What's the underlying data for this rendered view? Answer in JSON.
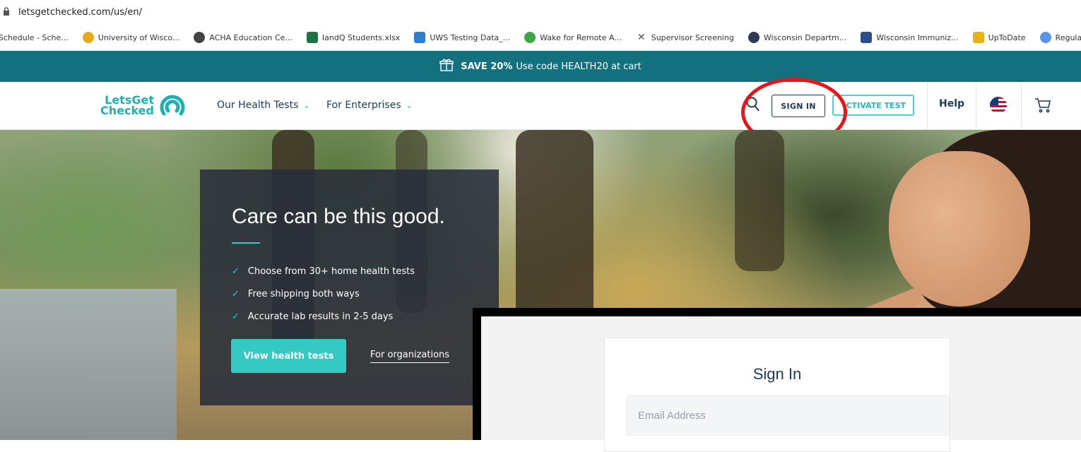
{
  "browser": {
    "url": "letsgetchecked.com/us/en/",
    "bookmarks": [
      {
        "label": "Schedule - Sche...",
        "icon": "calendar-icon",
        "color": "#ffffff"
      },
      {
        "label": "University of Wisco...",
        "icon": "university-icon",
        "color": "#e8a91c"
      },
      {
        "label": "ACHA Education Ce...",
        "icon": "globe-icon",
        "color": "#444444"
      },
      {
        "label": "IandQ Students.xlsx",
        "icon": "excel-icon",
        "color": "#1f7244"
      },
      {
        "label": "UWS Testing Data_...",
        "icon": "database-icon",
        "color": "#2d7dd2"
      },
      {
        "label": "Wake for Remote A...",
        "icon": "power-icon",
        "color": "#3aa845"
      },
      {
        "label": "Supervisor Screening",
        "icon": "cross-icon",
        "color": "#555555"
      },
      {
        "label": "Wisconsin Departm...",
        "icon": "star-badge-icon",
        "color": "#2b3a55"
      },
      {
        "label": "Wisconsin Immuniz...",
        "icon": "wir-icon",
        "color": "#2c4f8a"
      },
      {
        "label": "UpToDate",
        "icon": "uptodate-icon",
        "color": "#e8b415"
      },
      {
        "label": "Regulation and Pre...",
        "icon": "un-icon",
        "color": "#5b92e5"
      }
    ]
  },
  "promo": {
    "bold": "SAVE 20%",
    "text": "Use code HEALTH20 at cart",
    "bg_color": "#13707f"
  },
  "nav": {
    "logo_line1": "LetsGet",
    "logo_line2": "Checked",
    "tests_label": "Our Health Tests",
    "enterprises_label": "For Enterprises",
    "signin_label": "SIGN IN",
    "activate_label": "CTIVATE TEST",
    "help_label": "Help",
    "accent_color": "#1fb1b1"
  },
  "hero": {
    "title": "Care can be this good.",
    "bullets": [
      "Choose from 30+ home health tests",
      "Free shipping both ways",
      "Accurate lab results in 2-5 days"
    ],
    "primary_button": "View health tests",
    "secondary_link": "For organizations"
  },
  "signin": {
    "title": "Sign In",
    "email_placeholder": "Email Address"
  },
  "annotation": {
    "highlight_color": "#e8141a"
  }
}
